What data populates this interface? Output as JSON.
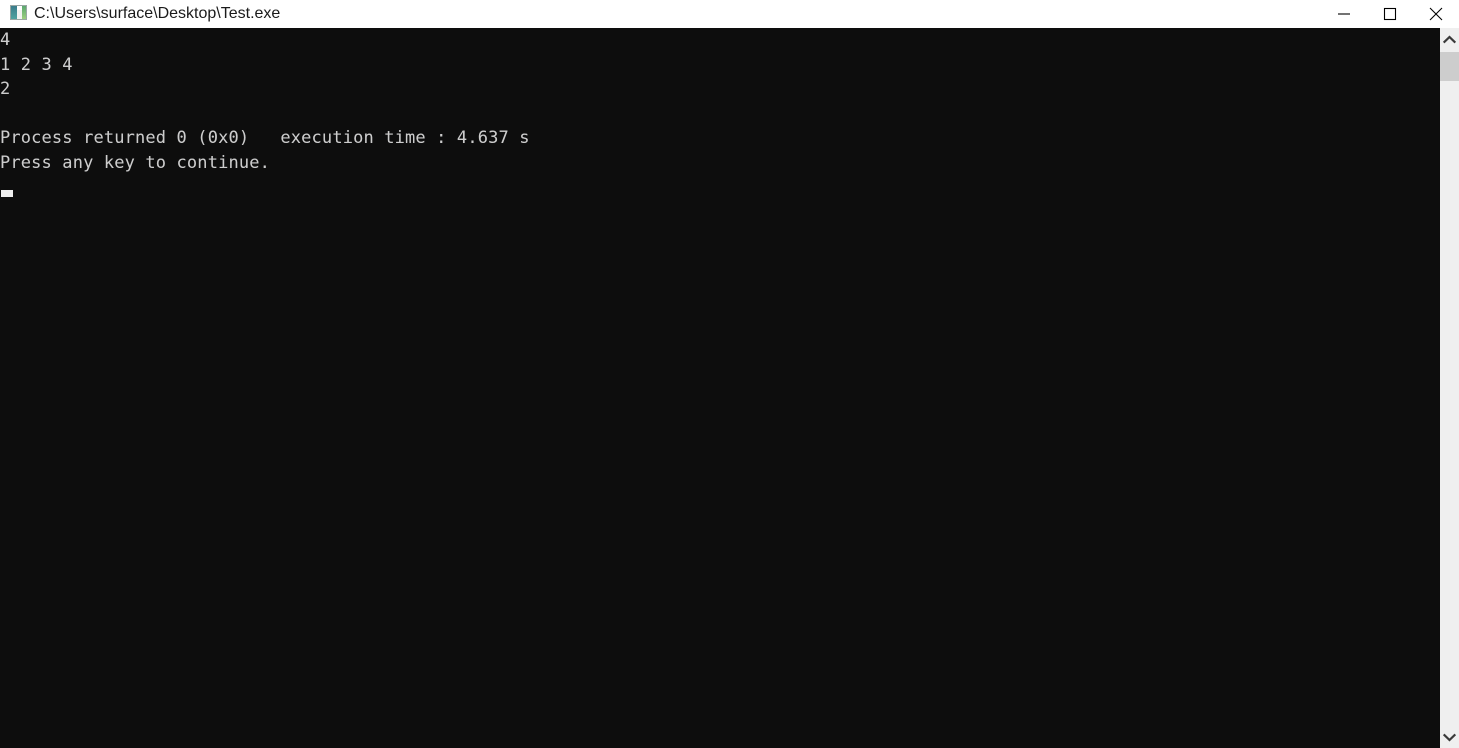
{
  "titlebar": {
    "icon_name": "console-app-icon",
    "title": "C:\\Users\\surface\\Desktop\\Test.exe",
    "minimize_label": "—",
    "maximize_label": "□",
    "close_label": "✕"
  },
  "console": {
    "background_color": "#0d0d0d",
    "text_color": "#cccccc",
    "output": "4\n1 2 3 4\n2\n\nProcess returned 0 (0x0)   execution time : 4.637 s\nPress any key to continue.",
    "lines": [
      "4",
      "1 2 3 4",
      "2",
      "",
      "Process returned 0 (0x0)   execution time : 4.637 s",
      "Press any key to continue."
    ],
    "cursor": {
      "visible": true,
      "color": "#eeeeee"
    }
  },
  "scrollbar": {
    "up_arrow_name": "scroll-up-arrow",
    "down_arrow_name": "scroll-down-arrow",
    "track_color": "#efefef",
    "thumb_color": "#cdcdcd"
  }
}
